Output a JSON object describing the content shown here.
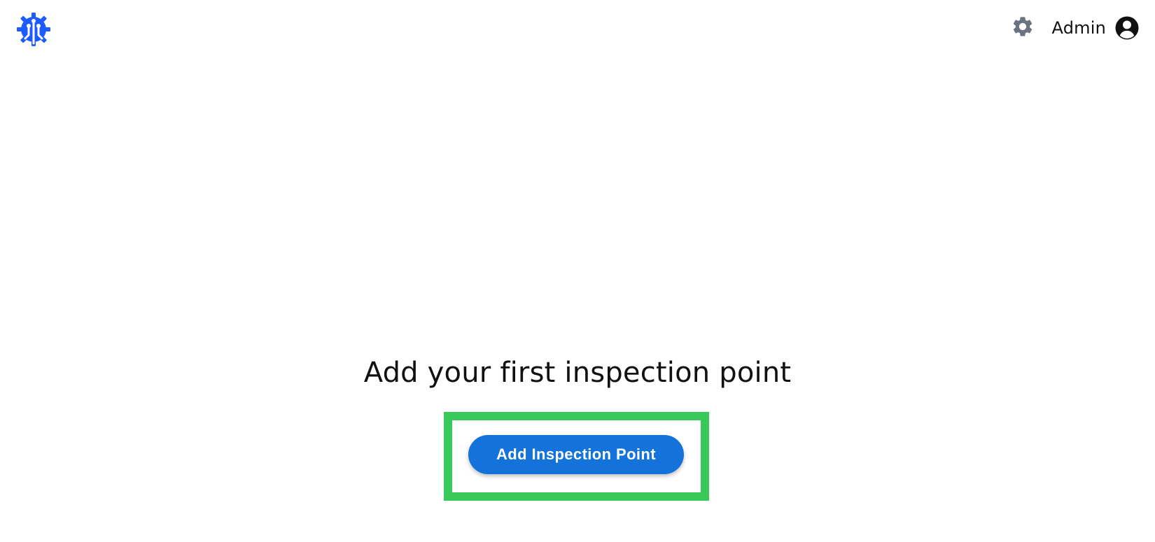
{
  "colors": {
    "brand_blue": "#1E5BFF",
    "button_blue": "#1473DB",
    "highlight_green": "#39C85A",
    "icon_gray": "#6B7280",
    "text": "#111111",
    "background": "#FFFFFF"
  },
  "header": {
    "logo_icon": "brand-logo-icon",
    "settings_icon": "gear-icon",
    "user": {
      "name": "Admin",
      "avatar_icon": "user-circle-icon"
    }
  },
  "main": {
    "headline": "Add your first inspection point",
    "primary_button_label": "Add Inspection Point"
  }
}
